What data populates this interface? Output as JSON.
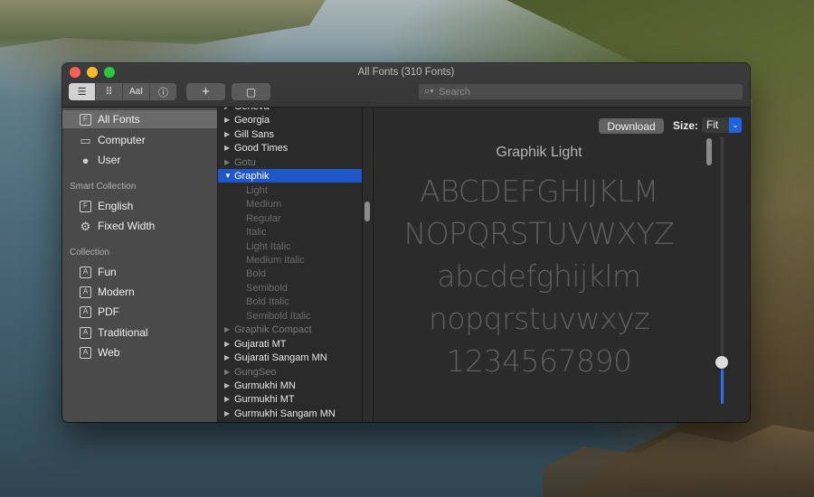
{
  "window": {
    "title": "All Fonts (310 Fonts)"
  },
  "toolbar": {
    "view_buttons": [
      {
        "name": "sample-view",
        "glyph": "☰"
      },
      {
        "name": "grid-view",
        "glyph": "⠿"
      },
      {
        "name": "custom-view",
        "glyph": "AaI"
      },
      {
        "name": "info-view",
        "glyph": "ⓘ"
      }
    ],
    "add_glyph": "+",
    "collection_glyph": "▢",
    "search": {
      "placeholder": "Search",
      "value": ""
    }
  },
  "sidebar": {
    "library_items": [
      {
        "label": "All Fonts",
        "icon": "font-file-icon",
        "glyph": "F",
        "selected": true
      },
      {
        "label": "Computer",
        "icon": "computer-icon",
        "glyph": "▭"
      },
      {
        "label": "User",
        "icon": "user-icon",
        "glyph": "●"
      }
    ],
    "smart_heading": "Smart Collection",
    "smart_items": [
      {
        "label": "English",
        "icon": "font-file-icon",
        "glyph": "F"
      },
      {
        "label": "Fixed Width",
        "icon": "gear-icon",
        "glyph": "⚙"
      }
    ],
    "collection_heading": "Collection",
    "collection_items": [
      {
        "label": "Fun",
        "icon": "font-collection-icon",
        "glyph": "A"
      },
      {
        "label": "Modern",
        "icon": "font-collection-icon",
        "glyph": "A"
      },
      {
        "label": "PDF",
        "icon": "font-collection-icon",
        "glyph": "A"
      },
      {
        "label": "Traditional",
        "icon": "font-collection-icon",
        "glyph": "A"
      },
      {
        "label": "Web",
        "icon": "font-collection-icon",
        "glyph": "A"
      }
    ],
    "add_glyph": "+"
  },
  "font_list": [
    {
      "label": "Geneva",
      "kind": "family",
      "partial": true
    },
    {
      "label": "Georgia",
      "kind": "family"
    },
    {
      "label": "Gill Sans",
      "kind": "family"
    },
    {
      "label": "Good Times",
      "kind": "family"
    },
    {
      "label": "Gotu",
      "kind": "family",
      "dim": true
    },
    {
      "label": "Graphik",
      "kind": "family",
      "selected": true,
      "expanded": true
    },
    {
      "label": "Light",
      "kind": "style"
    },
    {
      "label": "Medium",
      "kind": "style"
    },
    {
      "label": "Regular",
      "kind": "style"
    },
    {
      "label": "Italic",
      "kind": "style"
    },
    {
      "label": "Light Italic",
      "kind": "style"
    },
    {
      "label": "Medium Italic",
      "kind": "style"
    },
    {
      "label": "Bold",
      "kind": "style"
    },
    {
      "label": "Semibold",
      "kind": "style"
    },
    {
      "label": "Bold Italic",
      "kind": "style"
    },
    {
      "label": "Semibold Italic",
      "kind": "style"
    },
    {
      "label": "Graphik Compact",
      "kind": "family",
      "dim": true
    },
    {
      "label": "Gujarati MT",
      "kind": "family"
    },
    {
      "label": "Gujarati Sangam MN",
      "kind": "family"
    },
    {
      "label": "GungSeo",
      "kind": "family",
      "dim": true
    },
    {
      "label": "Gurmukhi MN",
      "kind": "family"
    },
    {
      "label": "Gurmukhi MT",
      "kind": "family"
    },
    {
      "label": "Gurmukhi Sangam MN",
      "kind": "family"
    }
  ],
  "preview": {
    "download_label": "Download",
    "size_label": "Size:",
    "size_value": "Fit",
    "font_name": "Graphik Light",
    "sample_lines": [
      "ABCDEFGHIJKLM",
      "NOPQRSTUVWXYZ",
      "abcdefghijklm",
      "nopqrstuvwxyz",
      "1234567890"
    ],
    "size_slider_level": 0.17
  },
  "colors": {
    "selection": "#1f57c9",
    "accent": "#2e6ff2"
  }
}
